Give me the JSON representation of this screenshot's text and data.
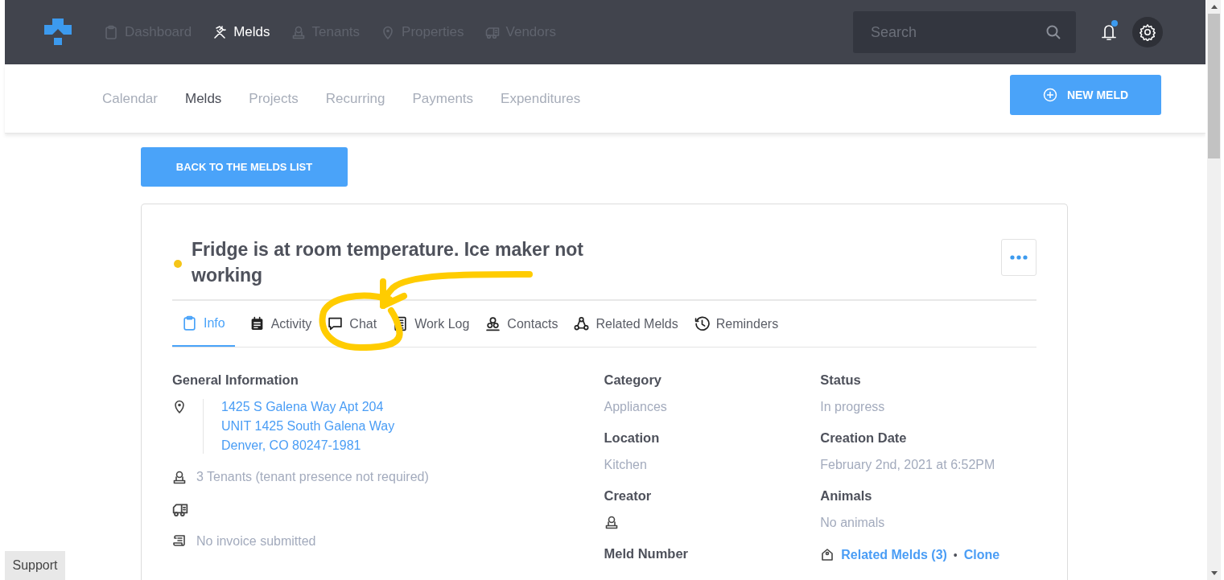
{
  "top_nav": {
    "items": [
      {
        "label": "Dashboard",
        "selected": false
      },
      {
        "label": "Melds",
        "selected": true
      },
      {
        "label": "Tenants",
        "selected": false
      },
      {
        "label": "Properties",
        "selected": false
      },
      {
        "label": "Vendors",
        "selected": false
      }
    ],
    "search": {
      "placeholder": "Search"
    },
    "notifications": {
      "unread": true
    }
  },
  "sub_nav": {
    "items": [
      {
        "label": "Calendar",
        "selected": false
      },
      {
        "label": "Melds",
        "selected": true
      },
      {
        "label": "Projects",
        "selected": false
      },
      {
        "label": "Recurring",
        "selected": false
      },
      {
        "label": "Payments",
        "selected": false
      },
      {
        "label": "Expenditures",
        "selected": false
      }
    ],
    "new_button": "NEW MELD"
  },
  "back_button": "BACK TO THE MELDS LIST",
  "meld": {
    "title": "Fridge is at room temperature. Ice maker not working",
    "tabs": [
      {
        "label": "Info",
        "selected": true
      },
      {
        "label": "Activity",
        "selected": false
      },
      {
        "label": "Chat",
        "selected": false
      },
      {
        "label": "Work Log",
        "selected": false
      },
      {
        "label": "Contacts",
        "selected": false
      },
      {
        "label": "Related Melds",
        "selected": false
      },
      {
        "label": "Reminders",
        "selected": false
      }
    ],
    "general": {
      "heading": "General Information",
      "address": [
        "1425 S Galena Way Apt 204",
        "UNIT 1425 South Galena Way",
        "Denver, CO 80247-1981"
      ],
      "tenants": "3 Tenants (tenant presence not required)",
      "invoice": "No invoice submitted"
    },
    "column_2": [
      {
        "label": "Category",
        "kind": "text",
        "value": "Appliances"
      },
      {
        "label": "Location",
        "kind": "text",
        "value": "Kitchen"
      },
      {
        "label": "Creator",
        "kind": "user"
      },
      {
        "label": "Meld Number",
        "kind": "none"
      }
    ],
    "column_3": [
      {
        "label": "Status",
        "kind": "text",
        "value": "In progress"
      },
      {
        "label": "Creation Date",
        "kind": "text",
        "value": "February 2nd, 2021 at 6:52PM"
      },
      {
        "label": "Animals",
        "kind": "text",
        "value": "No animals"
      },
      {
        "kind": "links",
        "links": [
          "Related Melds (3)",
          "Clone"
        ],
        "separator": "•"
      }
    ]
  },
  "support_button": "Support",
  "annotation": {
    "kind": "circle-arrow"
  }
}
